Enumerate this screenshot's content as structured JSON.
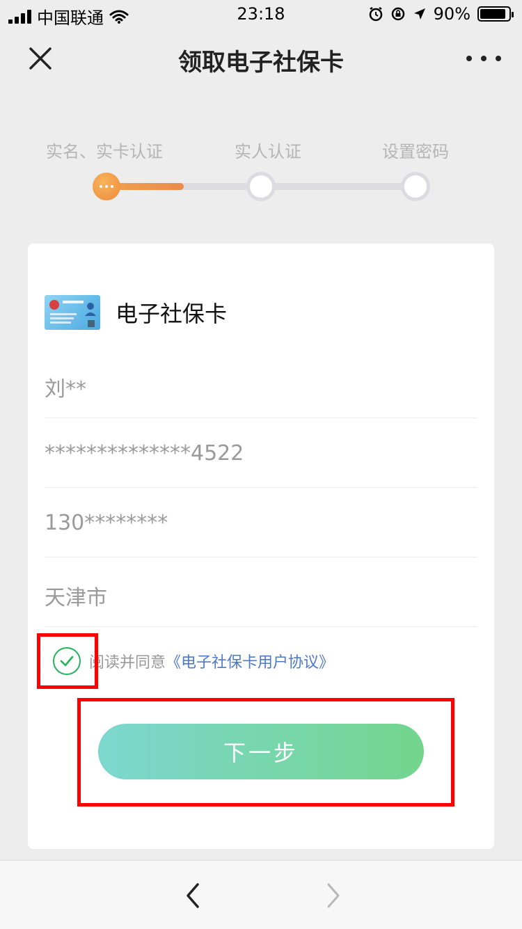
{
  "status_bar": {
    "carrier": "中国联通",
    "time": "23:18",
    "battery_pct": "90%",
    "battery_level": 0.9
  },
  "nav": {
    "title": "领取电子社保卡"
  },
  "steps": {
    "labels": [
      "实名、实卡认证",
      "实人认证",
      "设置密码"
    ],
    "current_step": 1,
    "progress_fraction": 0.25
  },
  "card": {
    "title": "电子社保卡",
    "fields": [
      {
        "value": "刘**"
      },
      {
        "value": "**************4522"
      },
      {
        "value": "130********"
      },
      {
        "value": "天津市"
      }
    ]
  },
  "agreement": {
    "checked": true,
    "prefix": "阅读并同意",
    "link": "《电子社保卡用户协议》"
  },
  "next_button": {
    "label": "下一步"
  },
  "colors": {
    "accent_orange": "#ee8a3c",
    "button_gradient_start": "#7cd7cf",
    "button_gradient_end": "#74d58d",
    "check_green": "#21b35a",
    "link_blue": "#4d79c8",
    "highlight_red": "#ff0000"
  },
  "icons": [
    "signal-icon",
    "wifi-icon",
    "alarm-icon",
    "rotation-lock-icon",
    "location-icon",
    "battery-icon",
    "close-icon",
    "more-icon",
    "checkmark-icon",
    "back-arrow-icon",
    "forward-arrow-icon"
  ]
}
